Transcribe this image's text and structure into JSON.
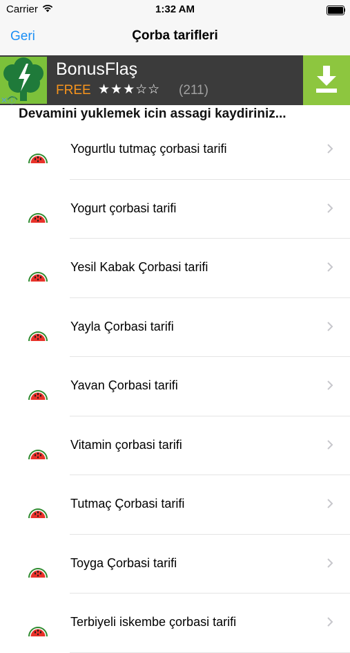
{
  "status_bar": {
    "carrier": "Carrier",
    "time": "1:32 AM"
  },
  "nav": {
    "back_label": "Geri",
    "title": "Çorba tarifleri"
  },
  "ad": {
    "app_name": "BonusFlaş",
    "price": "FREE",
    "stars": "★★★☆☆",
    "rating_value": 3.5,
    "rating_count": "(211)",
    "colors": {
      "banner": "#3b3b3b",
      "accent": "#8dc63f",
      "price": "#f7941d"
    }
  },
  "hint_text": "Devamini yuklemek icin assagi kaydiriniz...",
  "recipes": [
    {
      "label": "Yogurtlu tutmaç çorbasi tarifi"
    },
    {
      "label": "Yogurt çorbasi tarifi"
    },
    {
      "label": "Yesil Kabak Çorbasi tarifi"
    },
    {
      "label": "Yayla Çorbasi tarifi"
    },
    {
      "label": "Yavan Çorbasi tarifi"
    },
    {
      "label": "Vitamin çorbasi tarifi"
    },
    {
      "label": "Tutmaç Çorbasi tarifi"
    },
    {
      "label": "Toyga Çorbasi tarifi"
    },
    {
      "label": "Terbiyeli iskembe çorbasi tarifi"
    }
  ],
  "icons": {
    "row_icon": "watermelon-icon",
    "row_accessory": "chevron-right-icon"
  },
  "colors": {
    "link": "#1a8ef5",
    "separator": "#e4e4e4"
  }
}
